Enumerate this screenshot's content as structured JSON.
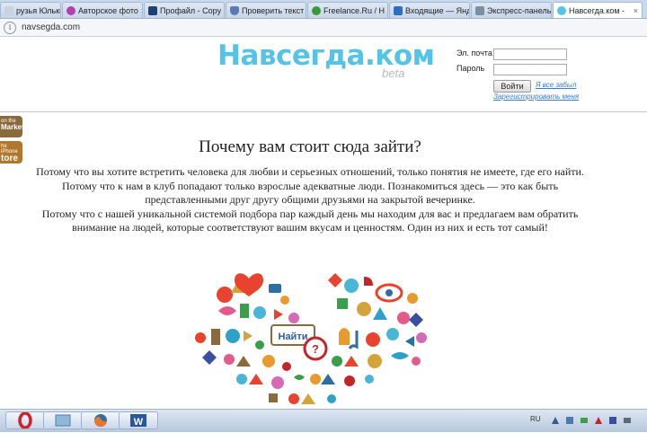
{
  "tabs": [
    {
      "label": "рузья Юльки М",
      "icon": "contact-icon",
      "color": "#c8d3e0"
    },
    {
      "label": "Авторское фото",
      "icon": "photo-site-icon",
      "color": "#b33fb3"
    },
    {
      "label": "Профайл - Сору",
      "icon": "profile-site-icon",
      "color": "#1d3f7a"
    },
    {
      "label": "Проверить текст",
      "icon": "shield-icon",
      "color": "#5a7bb5"
    },
    {
      "label": "Freelance.Ru / Н",
      "icon": "freelance-icon",
      "color": "#3a9a3a"
    },
    {
      "label": "Входящие — Янд",
      "icon": "mail-icon",
      "color": "#2d6fbf"
    },
    {
      "label": "Экспресс-панель",
      "icon": "grid-icon",
      "color": "#7d8ea3"
    },
    {
      "label": "Навсегда.ком -",
      "icon": "site-icon",
      "color": "#55c3e6",
      "active": true
    }
  ],
  "address": {
    "url": "navsegda.com"
  },
  "header": {
    "logo": "Навсегда.ком",
    "beta": "beta",
    "email_label": "Эл. почта",
    "password_label": "Пароль",
    "login_button": "Войти",
    "forgot_link": "Я все забыл",
    "register_link": "Зарегистрировать меня"
  },
  "badges": {
    "market_top": "on the",
    "market_bottom": "Market",
    "store_top": "he iPhone",
    "store_bottom": "tore"
  },
  "main": {
    "title": "Почему вам стоит сюда зайти?",
    "paragraphs": [
      "Потому что вы хотите встретить человека для любви и серьезных отношений, только понятия не имеете, где его найти.",
      "Потому что к нам в клуб попадают только взрослые адекватные люди. Познакомиться здесь — это как быть представленными друг другу общими друзьями на закрытой вечеринке.",
      "Потому что с нашей уникальной системой подбора пар каждый день мы находим для вас и предлагаем вам обратить внимание на людей, которые соответствуют вашим вкусам и ценностям. Один из них и есть тот самый!"
    ],
    "heart_sign": "Найти"
  },
  "taskbar": {
    "apps": [
      "opera-icon",
      "window-icon",
      "firefox-icon",
      "word-icon"
    ],
    "language": "RU"
  }
}
